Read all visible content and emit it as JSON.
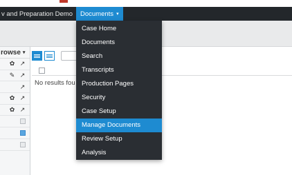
{
  "nav": {
    "case_title": "v and Preparation Demo",
    "separator": "|",
    "documents_menu": "Documents",
    "documents_caret": "▾"
  },
  "left_panel": {
    "browse_label": "rowse",
    "browse_caret": "▾",
    "rows": [
      {
        "icons": [
          "gear-icon",
          "external-link-icon"
        ]
      },
      {
        "icons": [
          "edit-icon",
          "external-link-icon"
        ]
      },
      {
        "icons": [
          "external-link-icon"
        ]
      },
      {
        "icons": [
          "gear-icon",
          "external-link-icon"
        ]
      },
      {
        "icons": [
          "gear-icon",
          "external-link-icon"
        ]
      },
      {
        "icons": [
          "checkbox-grey-icon"
        ]
      },
      {
        "icons": [
          "checkbox-blue-icon"
        ]
      },
      {
        "icons": [
          "checkbox-grey-icon"
        ]
      }
    ]
  },
  "main": {
    "no_results": "No results fou"
  },
  "dropdown": {
    "items": [
      "Case Home",
      "Documents",
      "Search",
      "Transcripts",
      "Production Pages",
      "Security",
      "Case Setup",
      "Manage Documents",
      "Review Setup",
      "Analysis"
    ],
    "active_item": "Manage Documents"
  },
  "colors": {
    "navbar": "#23272b",
    "accent_blue": "#1e8bd1",
    "dropdown_bg": "#2a2e33",
    "brand_red": "#c0392b"
  }
}
